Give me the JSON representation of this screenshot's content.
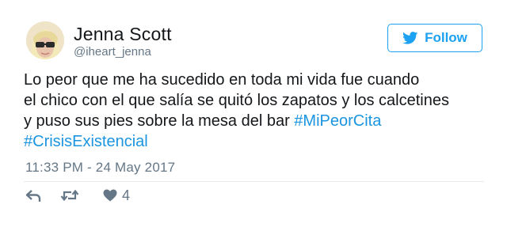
{
  "tweet": {
    "author_name": "Jenna Scott",
    "author_handle": "@iheart_jenna",
    "follow_label": "Follow",
    "text_lines": [
      "Lo peor que me ha sucedido en toda mi vida fue cuando",
      "el chico con el que salía se quitó los zapatos y los calcetines",
      "y puso sus pies sobre la mesa del bar "
    ],
    "hashtags": [
      "#MiPeorCita",
      "#CrisisExistencial"
    ],
    "timestamp": "11:33 PM - 24 May 2017",
    "like_count": "4"
  },
  "colors": {
    "accent": "#1da1f2",
    "hashtag": "#1b95e0",
    "secondary_text": "#657786",
    "icon": "#657786"
  },
  "icons": {
    "follow": "bird-icon",
    "reply": "reply-icon",
    "retweet": "retweet-icon",
    "like": "heart-icon"
  }
}
